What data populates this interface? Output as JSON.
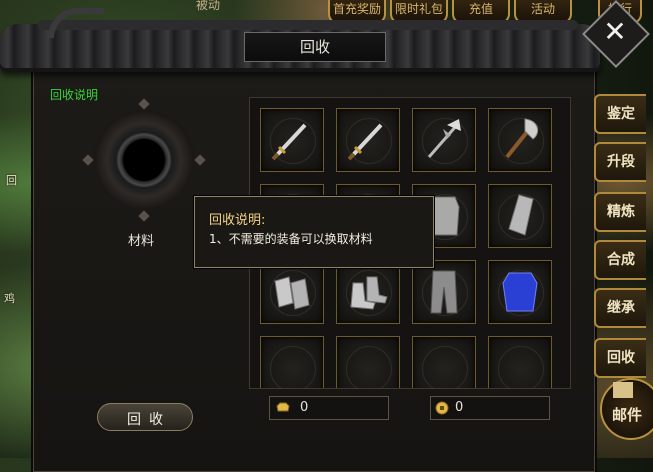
{
  "top_bar": {
    "partial_label": "被动",
    "tabs": [
      "首充奖励",
      "限时礼包",
      "充值",
      "活动",
      "排行"
    ]
  },
  "left_hud": {
    "chip1": "回",
    "chip2": "鸡"
  },
  "window": {
    "title": "回收",
    "close_label": "✕",
    "info_link": "回收说明",
    "materials_label": "材料",
    "recycle_button": "回收"
  },
  "grid": {
    "slots": [
      {
        "item": "sword"
      },
      {
        "item": "sword"
      },
      {
        "item": "halberd"
      },
      {
        "item": "axe"
      },
      {
        "item": "empty"
      },
      {
        "item": "empty"
      },
      {
        "item": "armor"
      },
      {
        "item": "cloak"
      },
      {
        "item": "bracers"
      },
      {
        "item": "boots"
      },
      {
        "item": "pants"
      },
      {
        "item": "blue-armor"
      },
      {
        "item": "empty"
      },
      {
        "item": "empty"
      },
      {
        "item": "empty"
      },
      {
        "item": "empty"
      }
    ]
  },
  "currency": {
    "gold_ingot": "0",
    "coin": "0"
  },
  "tooltip": {
    "title": "回收说明:",
    "line1": "1、不需要的装备可以换取材料"
  },
  "side_tabs": [
    "鉴定",
    "升段",
    "精炼",
    "合成",
    "继承",
    "回收"
  ],
  "mail": {
    "label": "邮件"
  },
  "colors": {
    "info_link": "#38d43a",
    "tooltip_title": "#f2d284",
    "slot_border": "#6f5a2a",
    "tab_border": "#b08a3a"
  }
}
